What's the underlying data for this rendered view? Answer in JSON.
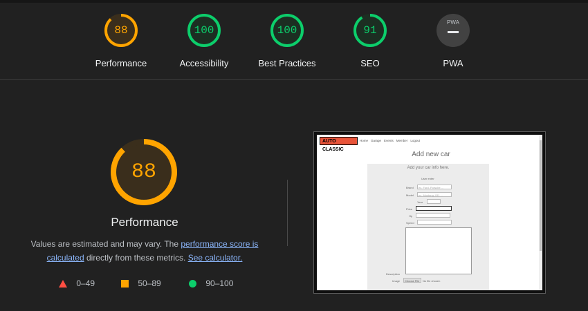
{
  "categories": [
    {
      "label": "Performance",
      "score": "88",
      "color": "#ffa400",
      "fraction": 0.88
    },
    {
      "label": "Accessibility",
      "score": "100",
      "color": "#0cce6b",
      "fraction": 1.0
    },
    {
      "label": "Best Practices",
      "score": "100",
      "color": "#0cce6b",
      "fraction": 1.0
    },
    {
      "label": "SEO",
      "score": "91",
      "color": "#0cce6b",
      "fraction": 0.91
    },
    {
      "label": "PWA",
      "badge": "PWA",
      "color": "#424242"
    }
  ],
  "main": {
    "score": "88",
    "score_fraction": 0.88,
    "title": "Performance",
    "desc_1": "Values are estimated and may vary. The ",
    "desc_link_1": "performance score is calculated",
    "desc_2": " directly from these metrics. ",
    "desc_link_2": "See calculator."
  },
  "legend": [
    {
      "range": "0–49",
      "color": "#ff4e42",
      "shape": "triangle"
    },
    {
      "range": "50–89",
      "color": "#ffa400",
      "shape": "square"
    },
    {
      "range": "90–100",
      "color": "#0cce6b",
      "shape": "circle"
    }
  ],
  "screenshot": {
    "logo": "AUTO CLASSIC",
    "nav": [
      "Home",
      "Garage",
      "Events",
      "Member",
      "Logout"
    ],
    "heading": "Add new car",
    "card_title": "Add your car info here.",
    "user_label": "User enter",
    "fields": [
      {
        "label": "Brand",
        "placeholder": "ex. Ford, Porsche ..."
      },
      {
        "label": "Model",
        "placeholder": "ex. Mustang, 911 ..."
      },
      {
        "label": "Year",
        "placeholder": ""
      },
      {
        "label": "Price",
        "placeholder": ""
      },
      {
        "label": "Hp",
        "placeholder": ""
      },
      {
        "label": "Speed",
        "placeholder": ""
      }
    ],
    "description_label": "Description",
    "image_label": "Image",
    "file_button": "Choose File",
    "file_status": "No file chosen"
  }
}
